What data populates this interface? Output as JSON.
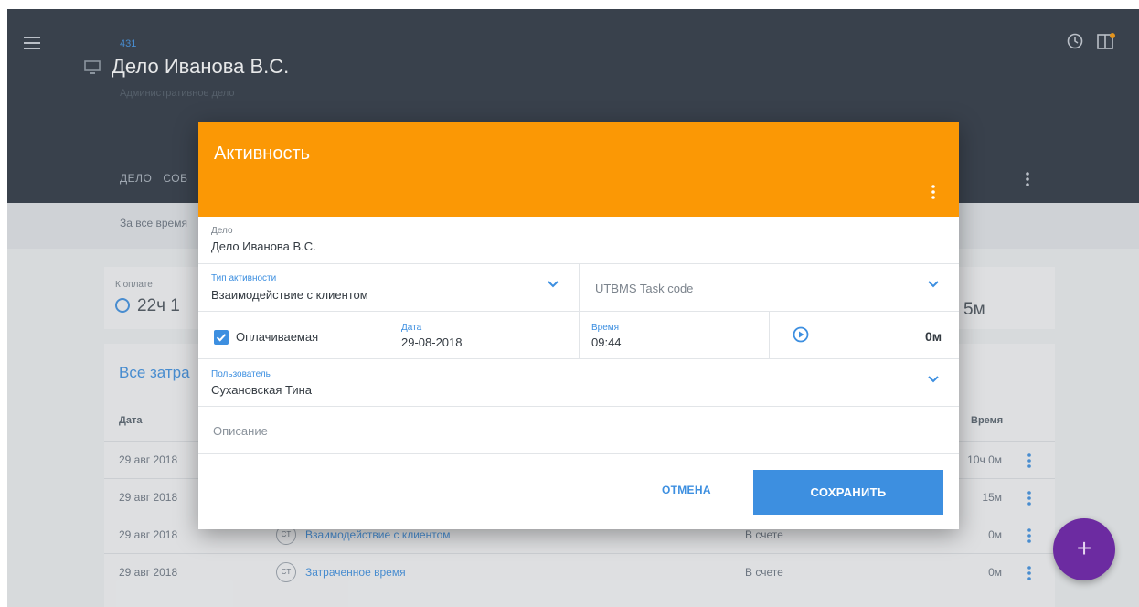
{
  "header": {
    "case_number": "431",
    "case_title": "Дело Иванова В.С.",
    "case_subtitle": "Административное дело",
    "tabs": [
      "ДЕЛО",
      "СОБ"
    ]
  },
  "filter": {
    "period_label": "За все время"
  },
  "summary": {
    "to_pay_label": "К оплате",
    "to_pay_value_visible": "22ч 1",
    "right_value_visible": "5м"
  },
  "table": {
    "title_visible": "Все затра",
    "col_date": "Дата",
    "col_time": "Время",
    "rows": [
      {
        "date": "29 авг 2018",
        "badge": "",
        "name": "",
        "status": "",
        "time": "10ч 0м"
      },
      {
        "date": "29 авг 2018",
        "badge": "",
        "name": "",
        "status": "",
        "time": "15м"
      },
      {
        "date": "29 авг 2018",
        "badge": "CT",
        "name": "Взаимодействие с клиентом",
        "status": "В счете",
        "time": "0м"
      },
      {
        "date": "29 авг 2018",
        "badge": "CT",
        "name": "Затраченное время",
        "status": "В счете",
        "time": "0м"
      }
    ]
  },
  "fab": {
    "label": "+"
  },
  "dialog": {
    "title": "Активность",
    "case": {
      "label": "Дело",
      "value": "Дело Иванова В.С."
    },
    "activity_type": {
      "label": "Тип активности",
      "value": "Взаимодействие с клиентом"
    },
    "utbms": {
      "placeholder": "UTBMS Task code"
    },
    "billable": {
      "label": "Оплачиваемая",
      "checked": true
    },
    "date": {
      "label": "Дата",
      "value": "29-08-2018"
    },
    "time": {
      "label": "Время",
      "value": "09:44"
    },
    "duration": "0м",
    "user": {
      "label": "Пользователь",
      "value": "Сухановская Тина"
    },
    "description": {
      "placeholder": "Описание"
    },
    "cancel_label": "ОТМЕНА",
    "save_label": "СОХРАНИТЬ"
  },
  "colors": {
    "appbar": "#2b3440",
    "dialog_header": "#fb9805",
    "accent_blue": "#3d8fe0",
    "fab": "#6c2ba1"
  }
}
